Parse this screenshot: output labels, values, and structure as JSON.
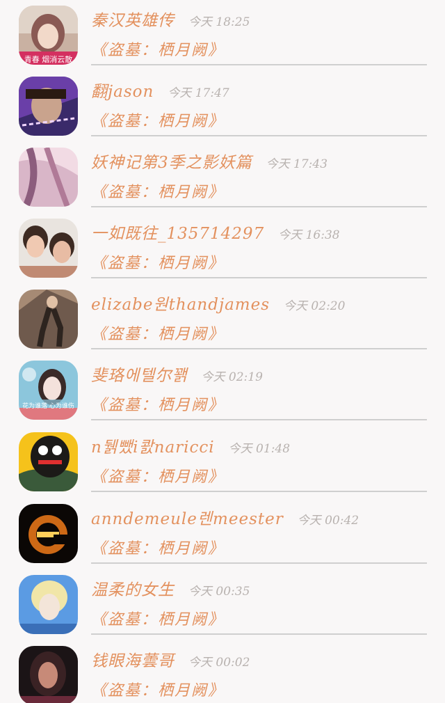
{
  "items": [
    {
      "name": "秦汉英雄传",
      "time": "今天 18:25",
      "book": "《盗墓：栖月阙》",
      "avatar_caption": "青春 烟消云散",
      "avatar_colors": [
        "#c9b1a2",
        "#8a5a54",
        "#d43060"
      ]
    },
    {
      "name": "翻jason",
      "time": "今天 17:47",
      "book": "《盗墓：栖月阙》",
      "avatar_caption": "",
      "avatar_colors": [
        "#3a2a6a",
        "#c9a38d",
        "#6a3fa8"
      ]
    },
    {
      "name": "妖神记第3季之影妖篇",
      "time": "今天 17:43",
      "book": "《盗墓：栖月阙》",
      "avatar_caption": "",
      "avatar_colors": [
        "#d9b6c8",
        "#8c5d7d",
        "#f2dbe4"
      ]
    },
    {
      "name": "一如既往_135714297",
      "time": "今天 16:38",
      "book": "《盗墓：栖月阙》",
      "avatar_caption": "",
      "avatar_colors": [
        "#e9e4df",
        "#c08a73",
        "#3d2a22"
      ]
    },
    {
      "name": "elizabe원thandjames",
      "time": "今天 02:20",
      "book": "《盗墓：栖月阙》",
      "avatar_caption": "",
      "avatar_colors": [
        "#6f5a4d",
        "#a68a74",
        "#2d241f"
      ]
    },
    {
      "name": "斐珞에텔尔꽭",
      "time": "今天 02:19",
      "book": "《盗墓：栖月阙》",
      "avatar_caption": "花为谁落  心为谁伤",
      "avatar_colors": [
        "#8cc6dc",
        "#f4e2dc",
        "#e0787f"
      ]
    },
    {
      "name": "n뒑뺐i콼naricci",
      "time": "今天 01:48",
      "book": "《盗墓：栖月阙》",
      "avatar_caption": "",
      "avatar_colors": [
        "#f5c21b",
        "#1c1a18",
        "#3a5a3a"
      ]
    },
    {
      "name": "anndemeule렌meester",
      "time": "今天 00:42",
      "book": "《盗墓：栖月阙》",
      "avatar_caption": "",
      "avatar_colors": [
        "#0b0705",
        "#f07a1a",
        "#ffcf5a"
      ]
    },
    {
      "name": "温柔的女生",
      "time": "今天 00:35",
      "book": "《盗墓：栖月阙》",
      "avatar_caption": "",
      "avatar_colors": [
        "#5b9be3",
        "#f3e5d9",
        "#f1e6a8"
      ]
    },
    {
      "name": "钱眼海蕓哥",
      "time": "今天 00:02",
      "book": "《盗墓：栖月阙》",
      "avatar_caption": "",
      "avatar_colors": [
        "#1b1416",
        "#c78a78",
        "#6a2a3a"
      ]
    }
  ]
}
